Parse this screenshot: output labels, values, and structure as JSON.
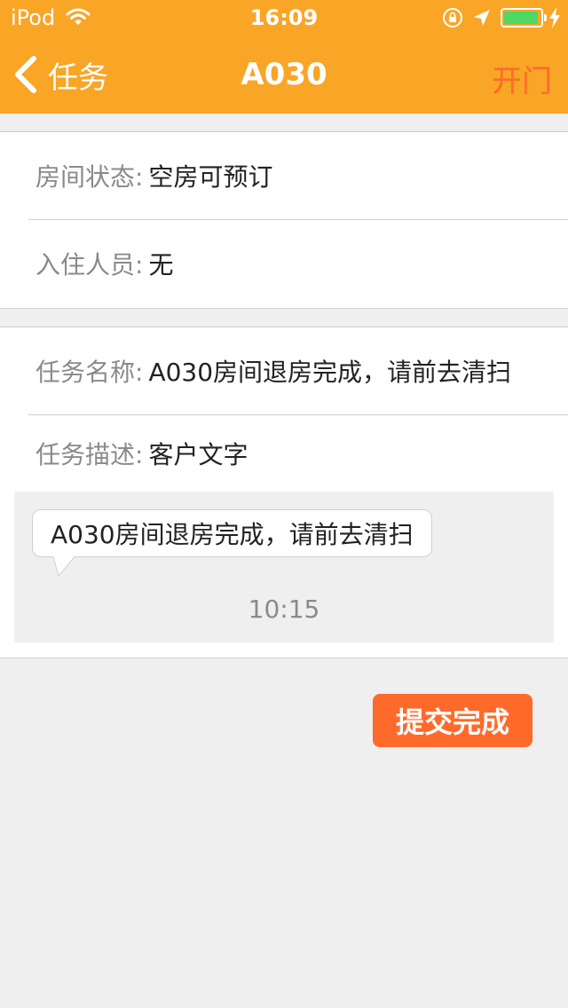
{
  "status_bar": {
    "carrier": "iPod",
    "time": "16:09"
  },
  "nav": {
    "back_label": "任务",
    "title": "A030",
    "right_action": "开门"
  },
  "room_info": {
    "status_label": "房间状态:",
    "status_value": "空房可预订",
    "guest_label": "入住人员:",
    "guest_value": "无"
  },
  "task": {
    "name_label": "任务名称:",
    "name_value": "A030房间退房完成，请前去清扫",
    "desc_label": "任务描述:",
    "desc_value": "客户文字",
    "message_text": "A030房间退房完成，请前去清扫",
    "message_time": "10:15"
  },
  "actions": {
    "submit_label": "提交完成"
  },
  "colors": {
    "header_bg": "#f9a526",
    "accent": "#ff6a2a",
    "battery": "#4cd964"
  }
}
